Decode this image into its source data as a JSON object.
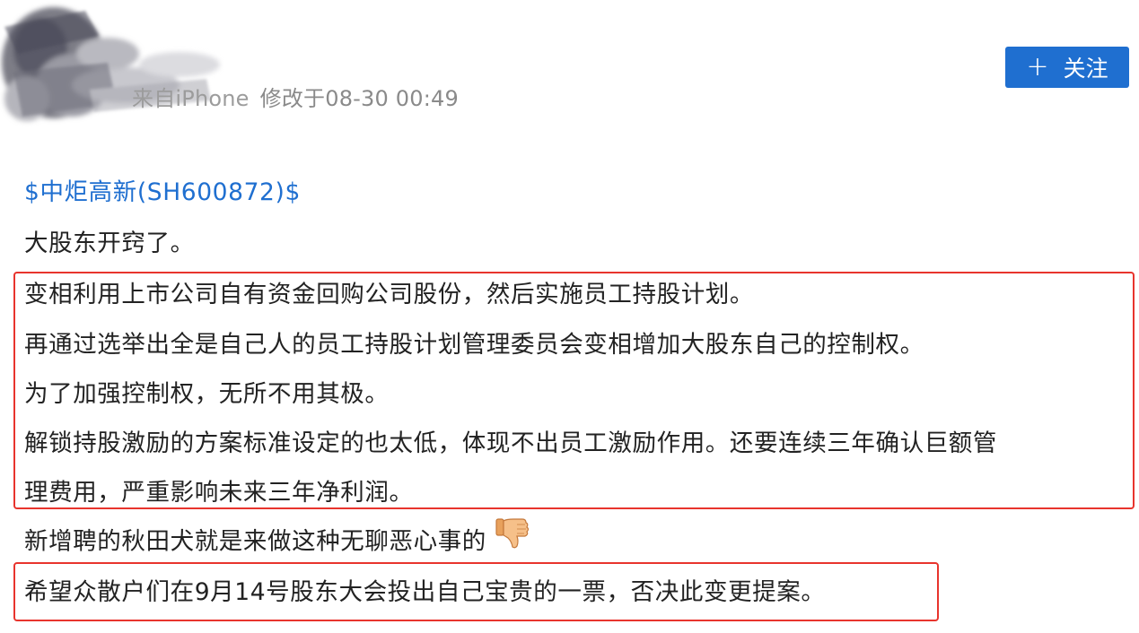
{
  "header": {
    "source": "来自iPhone",
    "modified": "修改于08-30 00:49",
    "follow_label": "关注",
    "follow_icon": "plus-icon"
  },
  "post": {
    "stock_link": "$中炬高新(SH600872)$",
    "lines": [
      "大股东开窍了。",
      "变相利用上市公司自有资金回购公司股份，然后实施员工持股计划。",
      "再通过选举出全是自己人的员工持股计划管理委员会变相增加大股东自己的控制权。",
      "为了加强控制权，无所不用其极。",
      "解锁持股激励的方案标准设定的也太低，体现不出员工激励作用。还要连续三年确认巨额管",
      "理费用，严重影响未来三年净利润。",
      "新增聘的秋田犬就是来做这种无聊恶心事的",
      "希望众散户们在9月14号股东大会投出自己宝贵的一票，否决此变更提案。"
    ],
    "emoji": "thumbs-down-icon"
  },
  "colors": {
    "link": "#1f6fd0",
    "button": "#1f6fd0",
    "highlight_box": "#e8342d",
    "meta_text": "#8a8a8a"
  }
}
